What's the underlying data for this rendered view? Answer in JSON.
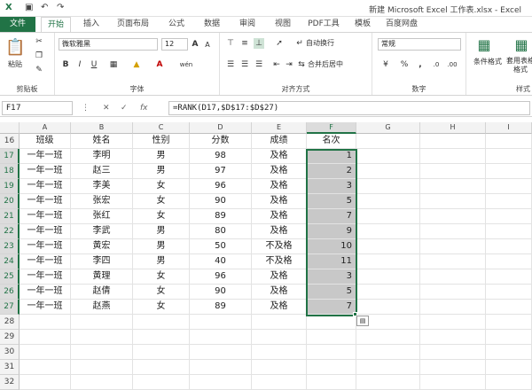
{
  "title": "新建 Microsoft Excel 工作表.xlsx - Excel",
  "tabs": [
    "文件",
    "开始",
    "插入",
    "页面布局",
    "公式",
    "数据",
    "审阅",
    "视图",
    "PDF工具",
    "模板",
    "百度网盘"
  ],
  "ribbon": {
    "clipboard_label": "剪贴板",
    "paste_label": "粘贴",
    "font_label": "字体",
    "font_name": "微软雅黑",
    "font_size": "12",
    "align_label": "对齐方式",
    "wrap_label": "自动换行",
    "merge_label": "合并后居中",
    "number_label": "数字",
    "number_format": "常规",
    "cond_label": "条件格式",
    "table_label": "套用表格格式",
    "style_label": "样式"
  },
  "formula_bar": {
    "name_box": "F17",
    "formula": "=RANK(D17,$D$17:$D$27)"
  },
  "columns": [
    "A",
    "B",
    "C",
    "D",
    "E",
    "F",
    "G",
    "H",
    "I"
  ],
  "selected_column": "F",
  "header_row": {
    "row": "16",
    "cells": [
      "班级",
      "姓名",
      "性别",
      "分数",
      "成绩",
      "名次"
    ]
  },
  "rows": [
    {
      "row": "17",
      "class": "一年一班",
      "name": "李明",
      "gender": "男",
      "score": "98",
      "grade": "及格",
      "rank": "1"
    },
    {
      "row": "18",
      "class": "一年一班",
      "name": "赵三",
      "gender": "男",
      "score": "97",
      "grade": "及格",
      "rank": "2"
    },
    {
      "row": "19",
      "class": "一年一班",
      "name": "李美",
      "gender": "女",
      "score": "96",
      "grade": "及格",
      "rank": "3"
    },
    {
      "row": "20",
      "class": "一年一班",
      "name": "张宏",
      "gender": "女",
      "score": "90",
      "grade": "及格",
      "rank": "5"
    },
    {
      "row": "21",
      "class": "一年一班",
      "name": "张红",
      "gender": "女",
      "score": "89",
      "grade": "及格",
      "rank": "7"
    },
    {
      "row": "22",
      "class": "一年一班",
      "name": "李武",
      "gender": "男",
      "score": "80",
      "grade": "及格",
      "rank": "9"
    },
    {
      "row": "23",
      "class": "一年一班",
      "name": "黄宏",
      "gender": "男",
      "score": "50",
      "grade": "不及格",
      "rank": "10"
    },
    {
      "row": "24",
      "class": "一年一班",
      "name": "李四",
      "gender": "男",
      "score": "40",
      "grade": "不及格",
      "rank": "11"
    },
    {
      "row": "25",
      "class": "一年一班",
      "name": "黄理",
      "gender": "女",
      "score": "96",
      "grade": "及格",
      "rank": "3"
    },
    {
      "row": "26",
      "class": "一年一班",
      "name": "赵倩",
      "gender": "女",
      "score": "90",
      "grade": "及格",
      "rank": "5"
    },
    {
      "row": "27",
      "class": "一年一班",
      "name": "赵燕",
      "gender": "女",
      "score": "89",
      "grade": "及格",
      "rank": "7"
    }
  ],
  "empty_rows": [
    "28",
    "29",
    "30",
    "31",
    "32"
  ],
  "colors": {
    "accent": "#217346",
    "selection_fill": "#c8c8c8"
  }
}
